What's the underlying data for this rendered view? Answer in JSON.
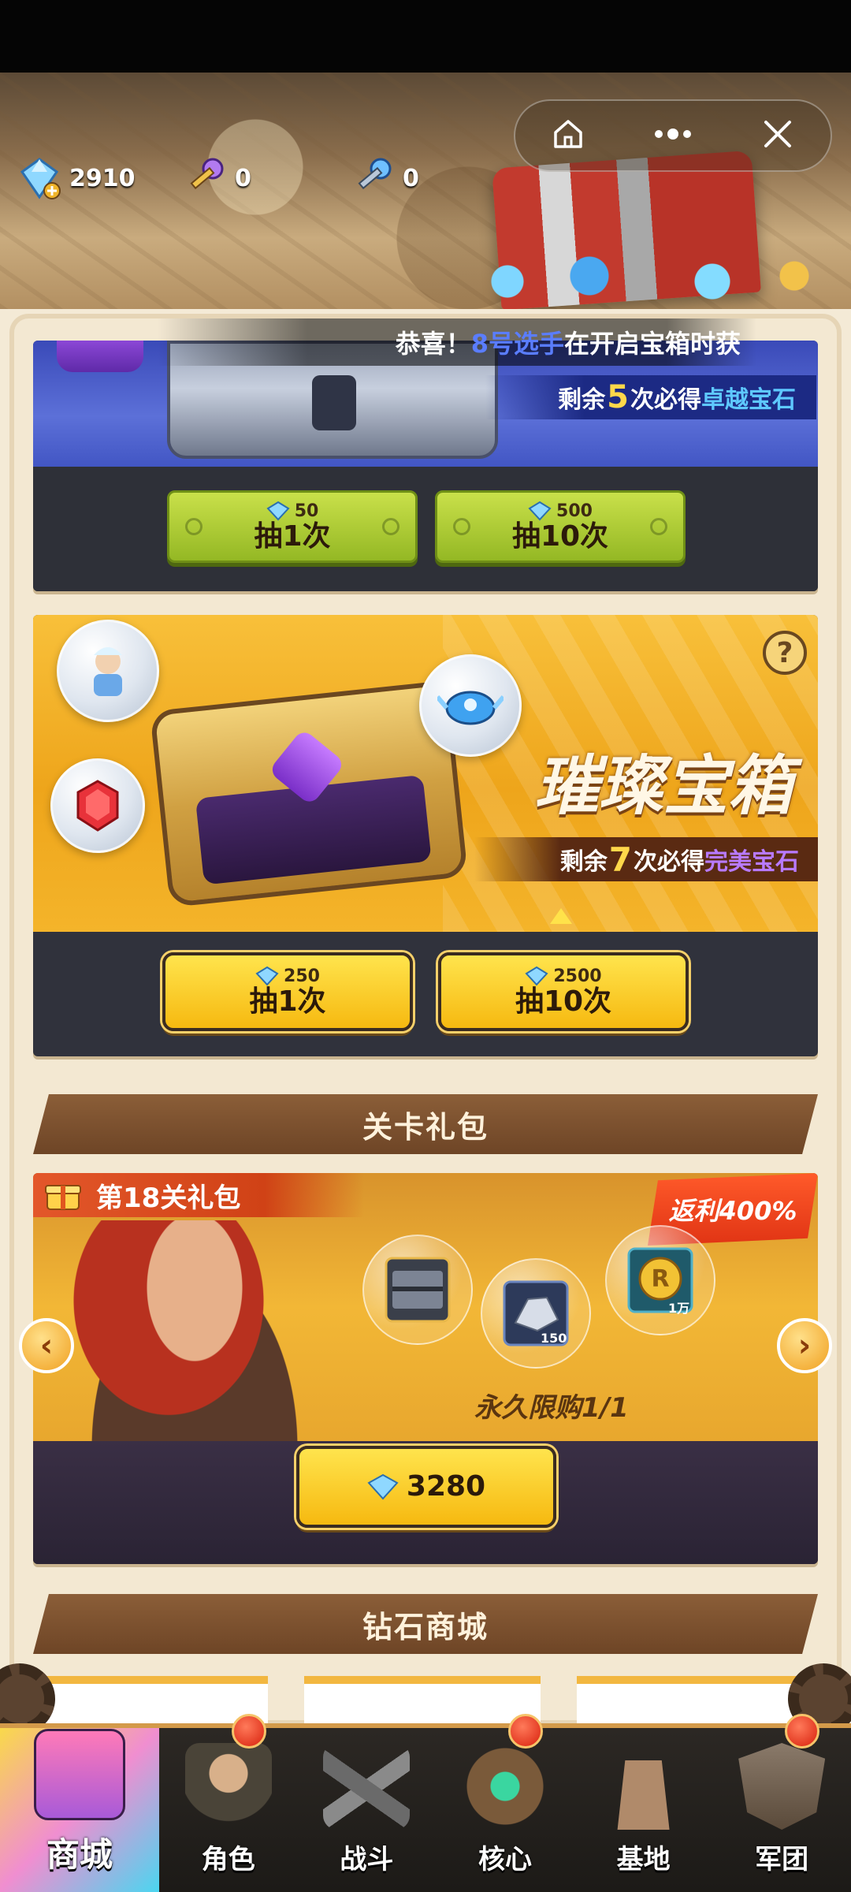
{
  "header": {
    "diamonds": "2910",
    "purple_keys": "0",
    "blue_keys": "0"
  },
  "ticker": {
    "prefix": "恭喜！",
    "player": "8号选手",
    "suffix": "在开启宝箱时获"
  },
  "chest1": {
    "remaining_prefix": "剩余",
    "remaining_count": "5",
    "remaining_mid": "次必得",
    "reward": "卓越宝石",
    "buttons": [
      {
        "cost": "50",
        "label": "抽1次"
      },
      {
        "cost": "500",
        "label": "抽10次"
      }
    ]
  },
  "chest2": {
    "title": "璀璨宝箱",
    "help": "?",
    "remaining_prefix": "剩余",
    "remaining_count": "7",
    "remaining_mid": "次必得",
    "reward": "完美宝石",
    "buttons": [
      {
        "cost": "250",
        "label": "抽1次"
      },
      {
        "cost": "2500",
        "label": "抽10次"
      }
    ]
  },
  "sections": {
    "stage_pack": "关卡礼包",
    "diamond_shop": "钻石商城"
  },
  "pack": {
    "badge": "第18关礼包",
    "rebate": "返利400%",
    "item2_count": "150",
    "item3_count": "1万",
    "limit": "永久限购1/1",
    "price": "3280"
  },
  "nav": [
    {
      "label": "商城",
      "active": true
    },
    {
      "label": "角色"
    },
    {
      "label": "战斗"
    },
    {
      "label": "核心"
    },
    {
      "label": "基地"
    },
    {
      "label": "军团"
    }
  ],
  "colors": {
    "accent_gold": "#f6b910",
    "accent_green": "#94b824",
    "highlight_blue": "#5ec8ff",
    "highlight_purple": "#b87aff"
  }
}
